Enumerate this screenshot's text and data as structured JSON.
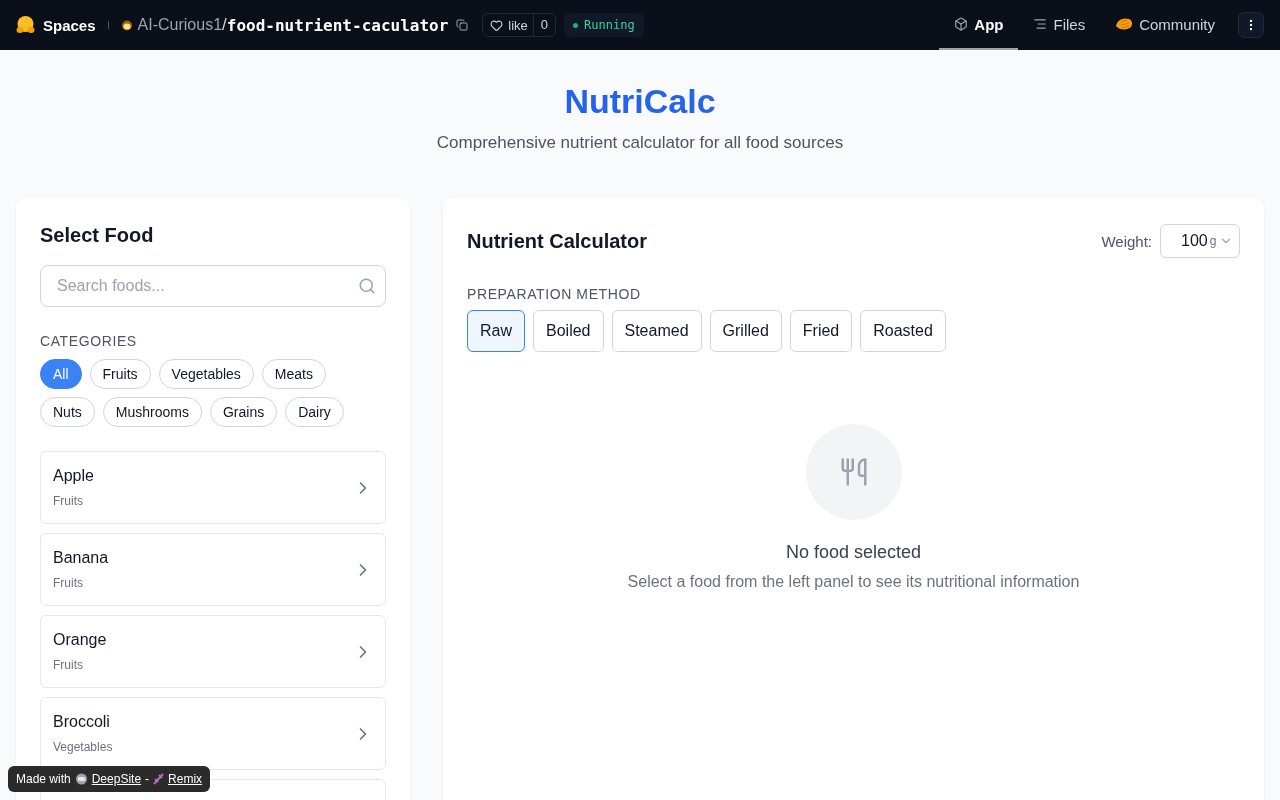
{
  "topbar": {
    "brand": "Spaces",
    "owner": "AI-Curious1",
    "separator": "/",
    "repo": "food-nutrient-caculator",
    "like_label": "like",
    "like_count": "0",
    "status": "Running",
    "tabs": [
      {
        "label": "App",
        "selected": true,
        "kind": "app"
      },
      {
        "label": "Files",
        "selected": false,
        "kind": "files"
      },
      {
        "label": "Community",
        "selected": false,
        "kind": "community"
      }
    ]
  },
  "header": {
    "title": "NutriCalc",
    "subtitle": "Comprehensive nutrient calculator for all food sources"
  },
  "sidebar": {
    "title": "Select Food",
    "search": {
      "placeholder": "Search foods..."
    },
    "categories_label": "CATEGORIES",
    "categories": [
      {
        "label": "All",
        "selected": true
      },
      {
        "label": "Fruits",
        "selected": false
      },
      {
        "label": "Vegetables",
        "selected": false
      },
      {
        "label": "Meats",
        "selected": false
      },
      {
        "label": "Nuts",
        "selected": false
      },
      {
        "label": "Mushrooms",
        "selected": false
      },
      {
        "label": "Grains",
        "selected": false
      },
      {
        "label": "Dairy",
        "selected": false
      }
    ],
    "foods": [
      {
        "name": "Apple",
        "category": "Fruits"
      },
      {
        "name": "Banana",
        "category": "Fruits"
      },
      {
        "name": "Orange",
        "category": "Fruits"
      },
      {
        "name": "Broccoli",
        "category": "Vegetables"
      }
    ]
  },
  "calculator": {
    "title": "Nutrient Calculator",
    "weight_label": "Weight:",
    "weight_value": "100",
    "weight_unit": "g",
    "method_label": "PREPARATION METHOD",
    "methods": [
      {
        "label": "Raw",
        "selected": true
      },
      {
        "label": "Boiled",
        "selected": false
      },
      {
        "label": "Steamed",
        "selected": false
      },
      {
        "label": "Grilled",
        "selected": false
      },
      {
        "label": "Fried",
        "selected": false
      },
      {
        "label": "Roasted",
        "selected": false
      }
    ],
    "empty_title": "No food selected",
    "empty_text": "Select a food from the left panel to see its nutritional information"
  },
  "badge": {
    "prefix": "Made with",
    "site": "DeepSite",
    "dash": "-",
    "remix": "Remix"
  }
}
